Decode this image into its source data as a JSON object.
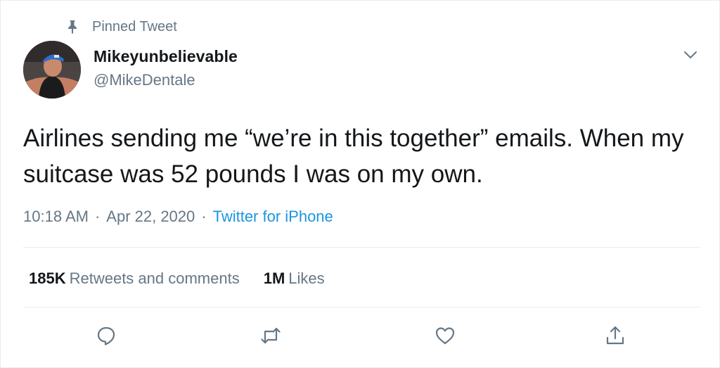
{
  "pinned": {
    "label": "Pinned Tweet",
    "icon": "pin-icon"
  },
  "author": {
    "display_name": "Mikeyunbelievable",
    "handle": "@MikeDentale",
    "avatar_icon": "avatar"
  },
  "tweet": {
    "text": "Airlines sending me “we’re in this together” emails. When my suitcase was 52 pounds I was on my own.",
    "time": "10:18 AM",
    "separator": "·",
    "date": "Apr 22, 2020",
    "source": "Twitter for iPhone"
  },
  "stats": {
    "retweets_count": "185K",
    "retweets_label": "Retweets and comments",
    "likes_count": "1M",
    "likes_label": "Likes"
  },
  "actions": [
    "reply-icon",
    "retweet-icon",
    "like-icon",
    "share-icon"
  ],
  "colors": {
    "text": "#14171a",
    "secondary": "#657786",
    "link": "#1b95e0",
    "border": "#e6ecf0"
  }
}
